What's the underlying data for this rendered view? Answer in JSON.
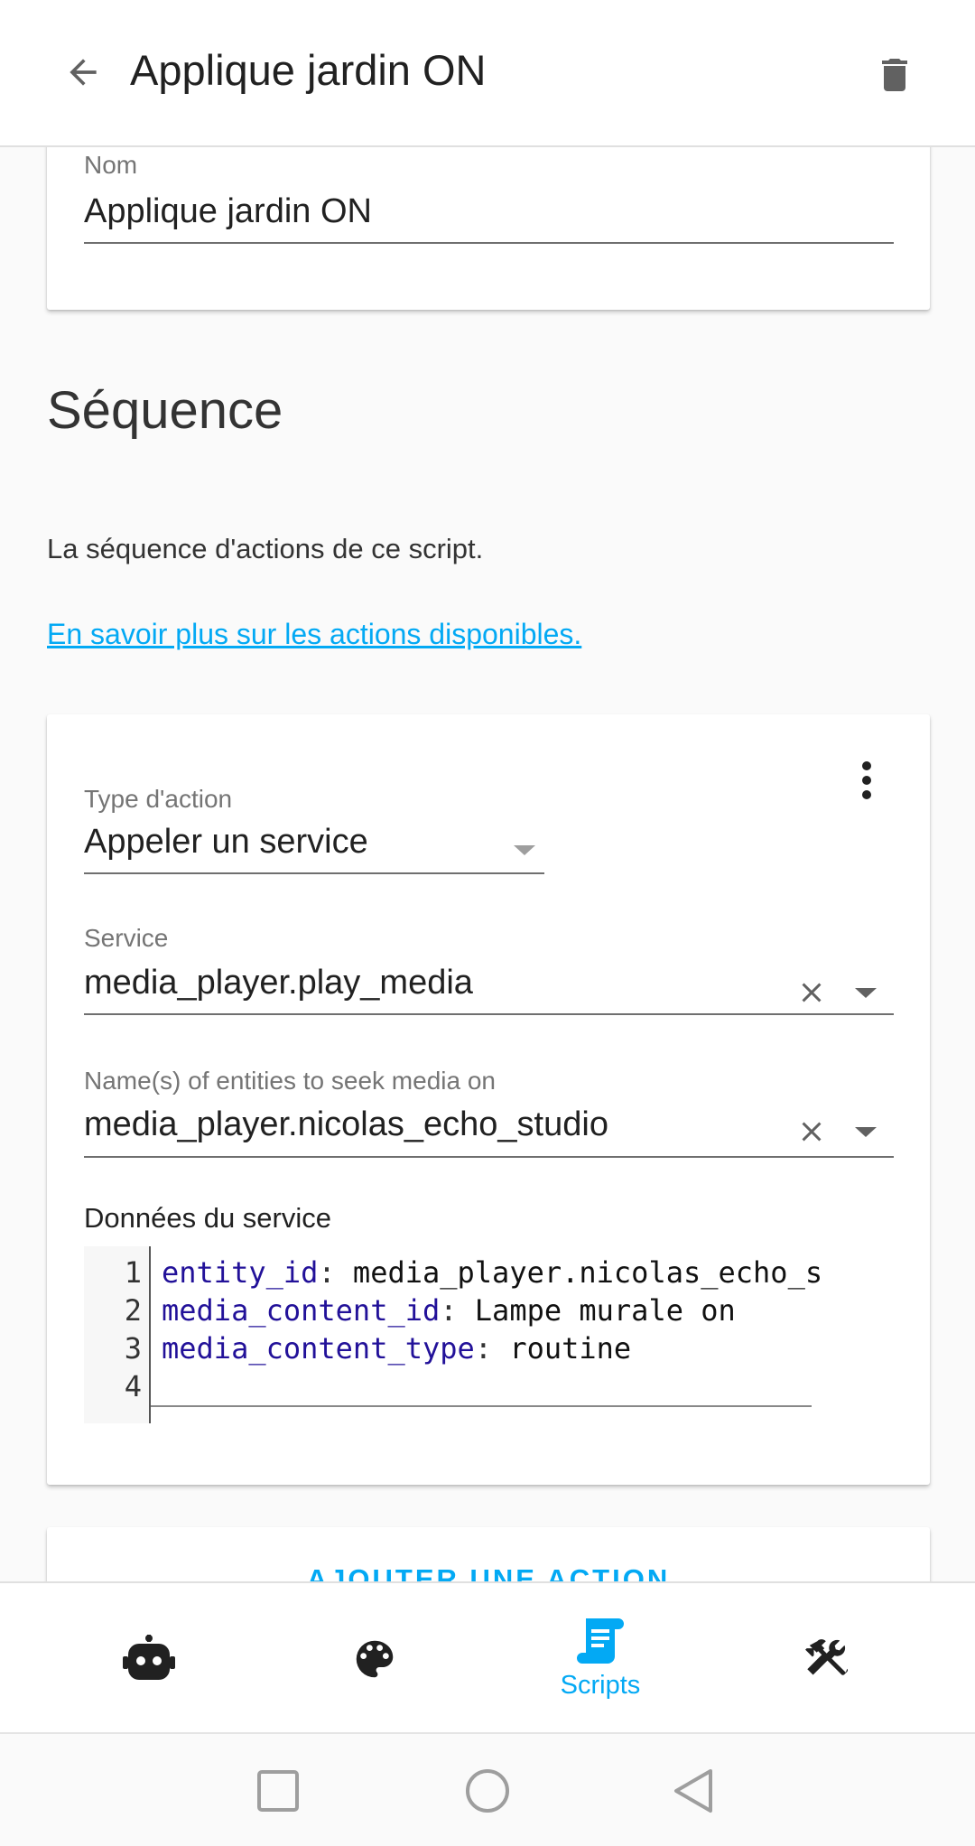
{
  "header": {
    "title": "Applique jardin ON"
  },
  "name_field": {
    "label": "Nom",
    "value": "Applique jardin ON"
  },
  "sequence": {
    "title": "Séquence",
    "description": "La séquence d'actions de ce script.",
    "link": "En savoir plus sur les actions disponibles."
  },
  "action": {
    "type_label": "Type d'action",
    "type_value": "Appeler un service",
    "service_label": "Service",
    "service_value": "media_player.play_media",
    "entities_label": "Name(s) of entities to seek media on",
    "entities_value": "media_player.nicolas_echo_studio",
    "data_label": "Données du service",
    "code": {
      "line_numbers": [
        "1",
        "2",
        "3",
        "4"
      ],
      "lines": [
        {
          "key": "entity_id",
          "value": "media_player.nicolas_echo_s"
        },
        {
          "key": "media_content_id",
          "value": "Lampe murale on"
        },
        {
          "key": "media_content_type",
          "value": "routine"
        }
      ]
    }
  },
  "add_action": {
    "label": "AJOUTER UNE ACTION"
  },
  "bottom_nav": {
    "items": [
      {
        "icon": "robot-icon",
        "label": ""
      },
      {
        "icon": "palette-icon",
        "label": ""
      },
      {
        "icon": "script-icon",
        "label": "Scripts"
      },
      {
        "icon": "tools-icon",
        "label": ""
      }
    ],
    "accent_color": "#03a9f4"
  },
  "colors": {
    "accent": "#03a9f4",
    "code_key": "#221199"
  }
}
